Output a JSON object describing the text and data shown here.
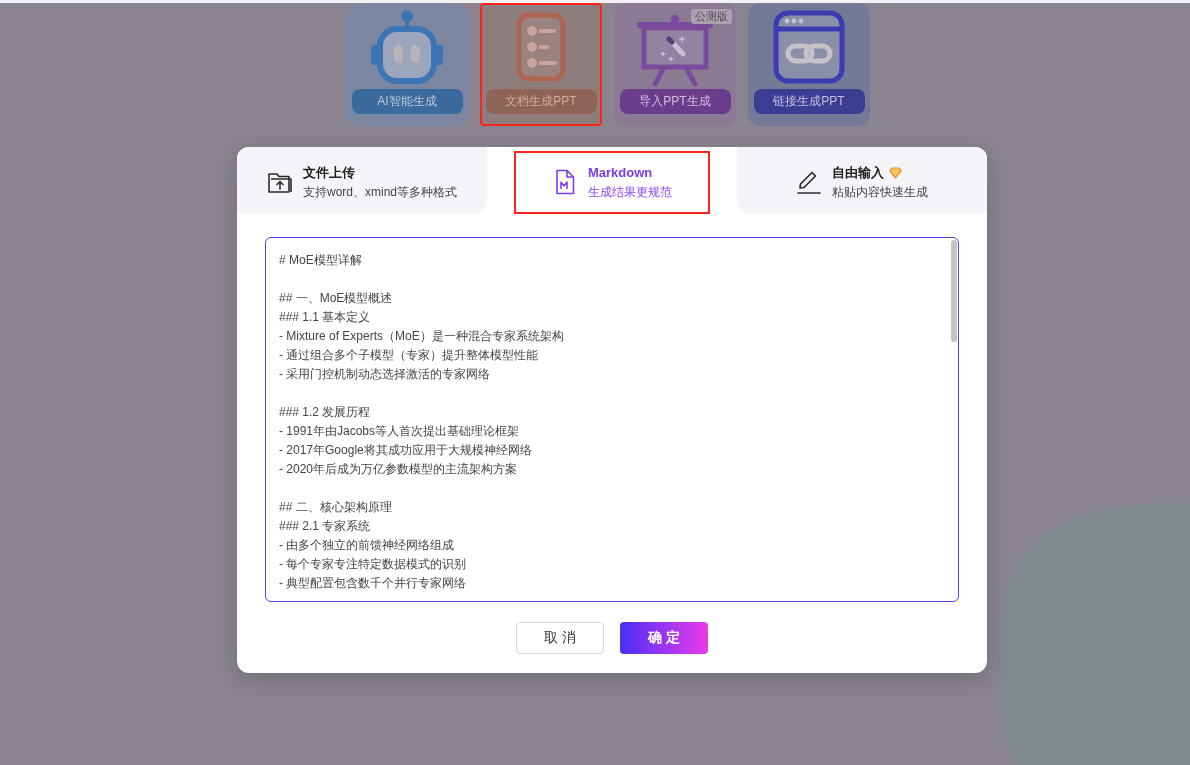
{
  "mode_cards": [
    {
      "kind": "ai",
      "label": "AI智能生成",
      "selected": false
    },
    {
      "kind": "document",
      "label": "文档生成PPT",
      "selected": true
    },
    {
      "kind": "import",
      "label": "导入PPT生成",
      "selected": false,
      "badge": "公测版"
    },
    {
      "kind": "link",
      "label": "链接生成PPT",
      "selected": false
    }
  ],
  "dialog": {
    "tabs": [
      {
        "kind": "upload",
        "title": "文件上传",
        "subtitle": "支持word、xmind等多种格式",
        "selected": false,
        "premium": false
      },
      {
        "kind": "markdown",
        "title": "Markdown",
        "subtitle": "生成结果更规范",
        "selected": true,
        "premium": false
      },
      {
        "kind": "text",
        "title": "自由输入",
        "subtitle": "粘贴内容快速生成",
        "selected": false,
        "premium": true
      }
    ],
    "editor": {
      "value": "# MoE模型详解\n\n## 一、MoE模型概述\n### 1.1 基本定义\n- Mixture of Experts（MoE）是一种混合专家系统架构\n- 通过组合多个子模型（专家）提升整体模型性能\n- 采用门控机制动态选择激活的专家网络\n\n### 1.2 发展历程\n- 1991年由Jacobs等人首次提出基础理论框架\n- 2017年Google将其成功应用于大规模神经网络\n- 2020年后成为万亿参数模型的主流架构方案\n\n## 二、核心架构原理\n### 2.1 专家系统\n- 由多个独立的前馈神经网络组成\n- 每个专家专注特定数据模式的识别\n- 典型配置包含数千个并行专家网络"
    },
    "buttons": [
      {
        "kind": "secondary",
        "label": "取 消"
      },
      {
        "kind": "primary",
        "label": "确 定"
      }
    ]
  }
}
